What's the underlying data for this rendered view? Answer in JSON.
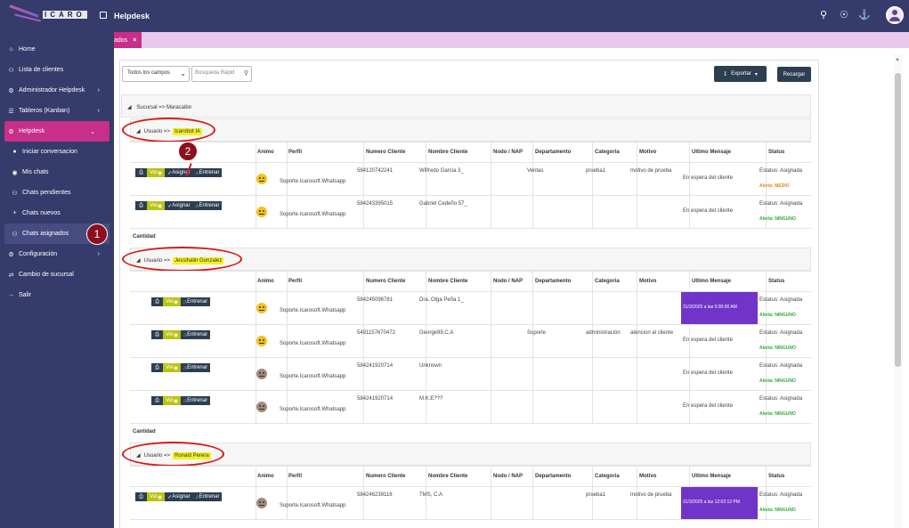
{
  "app": {
    "logo_text": "ICARO",
    "page_title": "Helpdesk"
  },
  "sidebar": {
    "items": [
      {
        "icon": "home-icon",
        "label": "Home"
      },
      {
        "icon": "users-icon",
        "label": "Lista de clientes"
      },
      {
        "icon": "settings-icon",
        "label": "Administrador Helpdesk"
      },
      {
        "icon": "list-icon",
        "label": "Tableros (Kanban)"
      },
      {
        "icon": "gear-icon",
        "label": "Helpdesk"
      }
    ],
    "submenu": [
      {
        "icon": "chat-icon",
        "label": "Iniciar conversacion"
      },
      {
        "icon": "chats-icon",
        "label": "Mis chats"
      },
      {
        "icon": "user-pending-icon",
        "label": "Chats pendientes"
      },
      {
        "icon": "plus-icon",
        "label": "Chats nuevos"
      },
      {
        "icon": "users-icon",
        "label": "Chats asignados"
      }
    ],
    "bottom": [
      {
        "icon": "gear-icon",
        "label": "Configuración"
      },
      {
        "icon": "exchange-icon",
        "label": "Cambio de sucursal"
      },
      {
        "icon": "logout-icon",
        "label": "Salir"
      }
    ],
    "step1": "1"
  },
  "tab": {
    "label": "ados",
    "close": "×"
  },
  "toolbar": {
    "select_value": "Todos los campos",
    "search_placeholder": "Búsqueda Rápid",
    "export_label": "Exportar",
    "reload_label": "Recargar"
  },
  "group": {
    "sucursal_label": "Sucursal => Maracaibo"
  },
  "headers": [
    "Animo",
    "Perfil",
    "Numero Cliente",
    "Nombre Cliente",
    "Nodo / NAP",
    "Departamento",
    "Categoria",
    "Motivo",
    "Ultimo Mensaje",
    "Status"
  ],
  "buttons": {
    "ver": "Ver",
    "asignar": "Asignar",
    "entrenar": "Entrenar"
  },
  "cantidad_label": "Cantidad",
  "step2": "2",
  "users": [
    {
      "prefix": "Usuario =>",
      "name": "Icarobot IA",
      "rows": [
        {
          "perfil": "Soporte.Icarosoft.Whatsapp",
          "numero": "584120742241",
          "nombre": "Wilfredo Garcia 3_",
          "departamento": "Ventas",
          "categoria": "prueba1",
          "motivo": "motivo de prueba",
          "mensaje": "En espera del cliente",
          "estatus": "Estatus: Asignada",
          "alerta": "Alerta: MEDIO",
          "alert_color": "#e08a1a",
          "emoji": "yellow",
          "asignar": true
        },
        {
          "perfil": "Soporte.Icarosoft.Whatsapp",
          "numero": "584243395015",
          "nombre": "Gabriel Cedeño 57_",
          "departamento": "",
          "categoria": "",
          "motivo": "",
          "mensaje": "En espera del cliente",
          "estatus": "Estatus: Asignada",
          "alerta": "Alerta: NINGUNO",
          "alert_color": "#2eaa3a",
          "emoji": "yellow",
          "asignar": true
        }
      ]
    },
    {
      "prefix": "Usuario =>",
      "name": "Jessihalin Gonzalez",
      "rows": [
        {
          "perfil": "Soporte.Icarosoft.Whatsapp",
          "numero": "584245096781",
          "nombre": "Dra. Olga Peña 1_",
          "departamento": "",
          "categoria": "",
          "motivo": "",
          "mensaje": "31/3/2025 a las 0:00:00 AM",
          "purple": true,
          "estatus": "Estatus: Asignada",
          "alerta": "Alerta: NINGUNO",
          "alert_color": "#2eaa3a",
          "emoji": "yellow",
          "asignar": false
        },
        {
          "perfil": "Soporte.Icarosoft.Whatsapp",
          "numero": "5491157670472",
          "nombre": "George99,C.A",
          "departamento": "Soporte",
          "categoria": "administración",
          "motivo": "atencion al cliente",
          "mensaje": "En espera del cliente",
          "estatus": "Estatus: Asignada",
          "alerta": "Alerta: NINGUNO",
          "alert_color": "#2eaa3a",
          "emoji": "yellow",
          "asignar": false
        },
        {
          "perfil": "Soporte.Icarosoft.Whatsapp",
          "numero": "584241920714",
          "nombre": "Unknown",
          "departamento": "",
          "categoria": "",
          "motivo": "",
          "mensaje": "En espera del cliente",
          "estatus": "Estatus: Asignada",
          "alerta": "Alerta: NINGUNO",
          "alert_color": "#2eaa3a",
          "emoji": "gray",
          "asignar": false
        },
        {
          "perfil": "Soporte.Icarosoft.Whatsapp",
          "numero": "584241920714",
          "nombre": "M.K.E???",
          "departamento": "",
          "categoria": "",
          "motivo": "",
          "mensaje": "En espera del cliente",
          "estatus": "Estatus: Asignada",
          "alerta": "Alerta: NINGUNO",
          "alert_color": "#2eaa3a",
          "emoji": "gray",
          "asignar": false
        }
      ]
    },
    {
      "prefix": "Usuario =>",
      "name": "Ronald Perera",
      "rows": [
        {
          "perfil": "Soporte.Icarosoft.Whatsapp",
          "numero": "584246239116",
          "nombre": "TMS, C.A",
          "departamento": "",
          "categoria": "prueba1",
          "motivo": "motivo de prueba",
          "mensaje": "31/3/2025 a las 12:02:12 PM",
          "purple": true,
          "estatus": "Estatus: Asignada",
          "alerta": "Alerta: NINGUNO",
          "alert_color": "#2eaa3a",
          "emoji": "gray",
          "asignar": true
        }
      ]
    }
  ]
}
